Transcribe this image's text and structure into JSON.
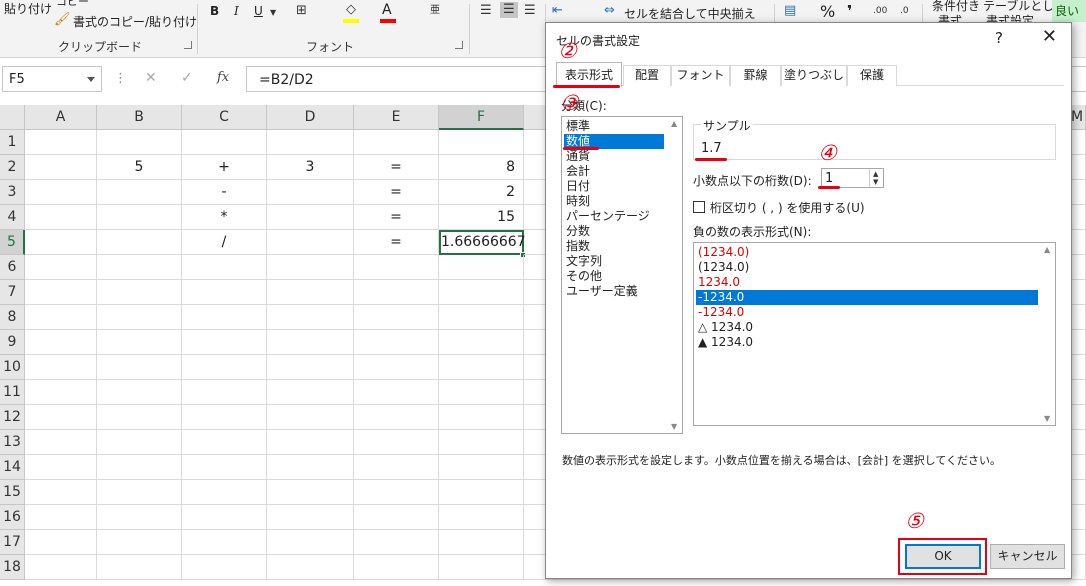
{
  "ribbon": {
    "paste_label": "貼り付け",
    "copy_label": "コピー",
    "format_painter_label": "書式のコピー/貼り付け",
    "clipboard_group": "クリップボード",
    "bold": "B",
    "italic": "I",
    "underline": "U",
    "font_color_glyph": "A",
    "font_group": "フォント",
    "merge_center_label": "セルを結合して中央揃え",
    "percent_glyph": "%",
    "comma_glyph": "❜",
    "conditional_format_label": "条件付き",
    "conditional_format_label2": "書式",
    "table_format_label": "テーブルとして",
    "table_format_label2": "書式設定",
    "good_style_label": "良い"
  },
  "formula_bar": {
    "name_box": "F5",
    "dots": "⋮",
    "cancel_glyph": "✕",
    "enter_glyph": "✓",
    "fx_label": "fx",
    "formula": "=B2/D2"
  },
  "sheet": {
    "columns": [
      "A",
      "B",
      "C",
      "D",
      "E",
      "F"
    ],
    "rows": [
      "1",
      "2",
      "3",
      "4",
      "5",
      "6",
      "7",
      "8",
      "9",
      "10",
      "11",
      "12",
      "13",
      "14",
      "15",
      "16",
      "17",
      "18"
    ],
    "partial_column": "M",
    "cells": {
      "B2": "5",
      "C2": "+",
      "D2": "3",
      "E2": "=",
      "F2": "8",
      "C3": "-",
      "E3": "=",
      "F3": "2",
      "C4": "*",
      "E4": "=",
      "F4": "15",
      "C5": "/",
      "E5": "=",
      "F5": "1.66666667"
    },
    "selected_cell": "F5"
  },
  "dialog": {
    "title": "セルの書式設定",
    "help_glyph": "?",
    "close_glyph": "✕",
    "tabs": [
      "表示形式",
      "配置",
      "フォント",
      "罫線",
      "塗りつぶし",
      "保護"
    ],
    "active_tab": "表示形式",
    "category_label": "分類(C):",
    "categories": [
      "標準",
      "数値",
      "通貨",
      "会計",
      "日付",
      "時刻",
      "パーセンテージ",
      "分数",
      "指数",
      "文字列",
      "その他",
      "ユーザー定義"
    ],
    "selected_category": "数値",
    "sample_legend": "サンプル",
    "sample_value": "1.7",
    "decimal_label": "小数点以下の桁数(D):",
    "decimal_value": "1",
    "separator_label": "桁区切り ( , ) を使用する(U)",
    "separator_checked": false,
    "negative_label": "負の数の表示形式(N):",
    "negative_formats": [
      {
        "text": "(1234.0)",
        "red": true
      },
      {
        "text": "(1234.0)",
        "red": false
      },
      {
        "text": "1234.0",
        "red": true
      },
      {
        "text": "-1234.0",
        "red": false,
        "selected": true
      },
      {
        "text": "-1234.0",
        "red": true
      },
      {
        "text": "△ 1234.0",
        "red": false
      },
      {
        "text": "▲ 1234.0",
        "red": false
      }
    ],
    "description": "数値の表示形式を設定します。小数点位置を揃える場合は、[会計] を選択してください。",
    "ok_label": "OK",
    "cancel_label": "キャンセル"
  },
  "annotations": {
    "step2": "②",
    "step3": "③",
    "step4": "④",
    "step5": "⑤",
    "color": "#e60012"
  }
}
